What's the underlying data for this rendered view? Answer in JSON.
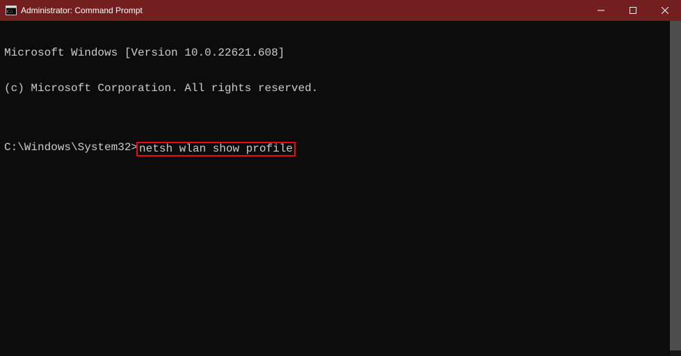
{
  "titlebar": {
    "title": "Administrator: Command Prompt"
  },
  "terminal": {
    "line1": "Microsoft Windows [Version 10.0.22621.608]",
    "line2": "(c) Microsoft Corporation. All rights reserved.",
    "blank": "",
    "prompt": "C:\\Windows\\System32>",
    "command": "netsh wlan show profile"
  }
}
